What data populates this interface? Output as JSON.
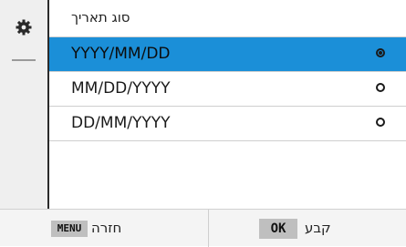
{
  "sidebar": {
    "icon": "gear-icon"
  },
  "menu": {
    "title": "סוג תאריך",
    "options": [
      {
        "label": "YYYY/MM/DD",
        "selected": true
      },
      {
        "label": "MM/DD/YYYY",
        "selected": false
      },
      {
        "label": "DD/MM/YYYY",
        "selected": false
      }
    ]
  },
  "footer": {
    "back_key": "MENU",
    "back_label": "חזרה",
    "set_key": "OK",
    "set_label": "קבע"
  },
  "colors": {
    "selected_row": "#1b8fd8"
  }
}
